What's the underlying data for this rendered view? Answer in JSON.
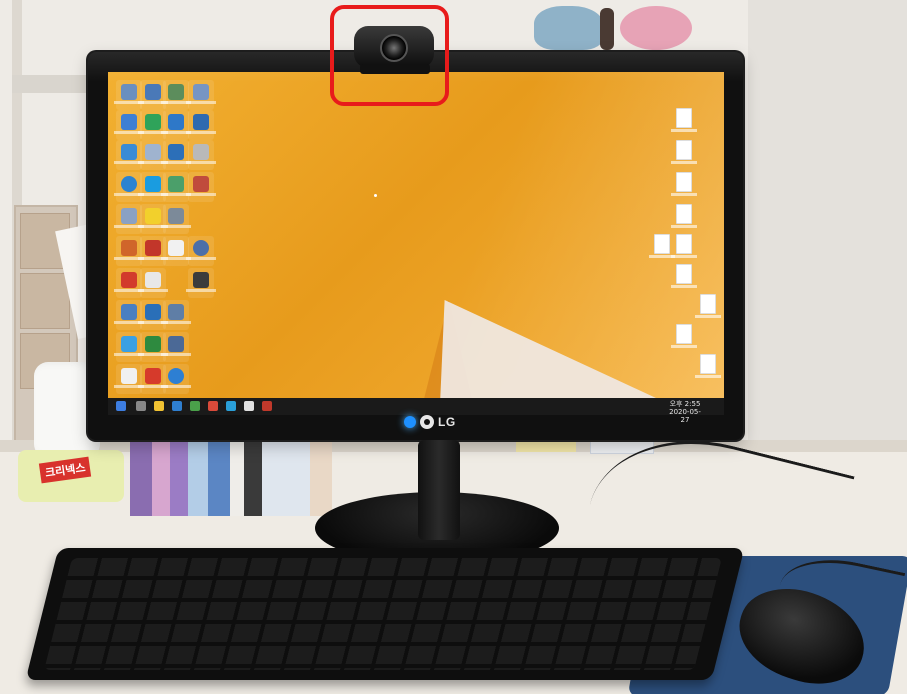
{
  "scene": {
    "monitor_brand": "LG",
    "tissue_brand": "크리넥스",
    "highlight": {
      "object": "webcam",
      "color": "#e81b1b"
    },
    "colors": {
      "desktop_orange": "#e79b1c",
      "power_led": "#1e90ff",
      "mousepad_blue": "#2c4f7d"
    }
  },
  "screen": {
    "clock_time": "오후 2:55",
    "clock_date": "2020-05-27"
  }
}
